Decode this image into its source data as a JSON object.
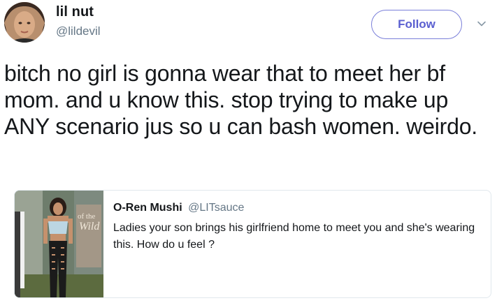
{
  "tweet": {
    "author": {
      "display_name": "lil nut",
      "handle": "@lildevil"
    },
    "follow_label": "Follow",
    "text": "bitch no girl is gonna wear that to meet her bf mom. and u know this. stop trying to make up ANY scenario jus so u can bash women. weirdo."
  },
  "quoted_tweet": {
    "author": {
      "display_name": "O-Ren Mushi",
      "handle": "@LITsauce"
    },
    "text": "Ladies your son brings his girlfriend home to meet you and she's wearing this. How do u feel ?"
  },
  "colors": {
    "accent": "#5a5fd0",
    "text_primary": "#14171a",
    "text_secondary": "#657786",
    "border": "#e1e8ed"
  },
  "icons": {
    "more": "chevron-down-icon"
  }
}
